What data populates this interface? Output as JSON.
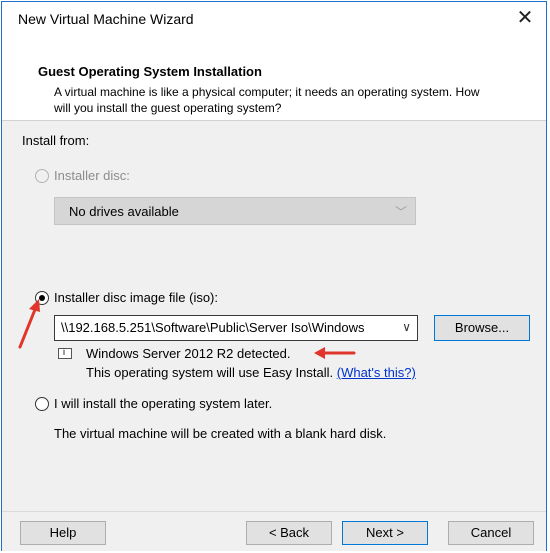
{
  "window": {
    "title": "New Virtual Machine Wizard"
  },
  "header": {
    "title": "Guest Operating System Installation",
    "description": "A virtual machine is like a physical computer; it needs an operating system. How will you install the guest operating system?"
  },
  "install_from": {
    "label": "Install from:",
    "installer_disc": {
      "label": "Installer disc:",
      "selected": false,
      "enabled": false,
      "dropdown_value": "No drives available"
    },
    "iso_file": {
      "label": "Installer disc image file (iso):",
      "selected": true,
      "path": "\\\\192.168.5.251\\Software\\Public\\Server Iso\\Windows",
      "browse_label": "Browse...",
      "detected_text": "Windows Server 2012 R2 detected.",
      "easy_install_text": "This operating system will use Easy Install.",
      "whats_this_link": "(What's this?)"
    },
    "install_later": {
      "label": "I will install the operating system later.",
      "selected": false,
      "description": "The virtual machine will be created with a blank hard disk."
    }
  },
  "footer": {
    "help": "Help",
    "back": "< Back",
    "next": "Next >",
    "cancel": "Cancel"
  },
  "colors": {
    "annotation_arrow": "#e0352b",
    "accent": "#0078d7",
    "link": "#0033cc"
  }
}
